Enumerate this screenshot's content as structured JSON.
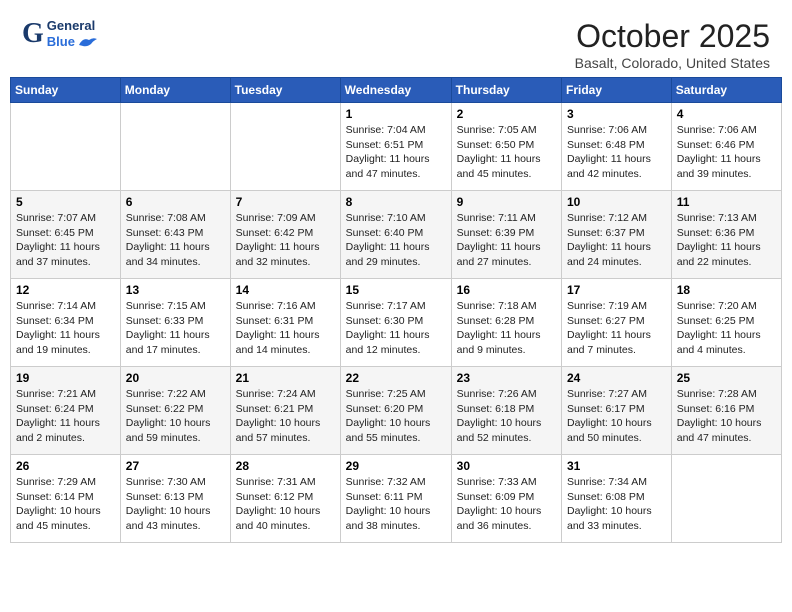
{
  "header": {
    "logo_general": "General",
    "logo_blue": "Blue",
    "month_title": "October 2025",
    "location": "Basalt, Colorado, United States"
  },
  "days_of_week": [
    "Sunday",
    "Monday",
    "Tuesday",
    "Wednesday",
    "Thursday",
    "Friday",
    "Saturday"
  ],
  "weeks": [
    [
      {
        "day": "",
        "info": ""
      },
      {
        "day": "",
        "info": ""
      },
      {
        "day": "",
        "info": ""
      },
      {
        "day": "1",
        "info": "Sunrise: 7:04 AM\nSunset: 6:51 PM\nDaylight: 11 hours\nand 47 minutes."
      },
      {
        "day": "2",
        "info": "Sunrise: 7:05 AM\nSunset: 6:50 PM\nDaylight: 11 hours\nand 45 minutes."
      },
      {
        "day": "3",
        "info": "Sunrise: 7:06 AM\nSunset: 6:48 PM\nDaylight: 11 hours\nand 42 minutes."
      },
      {
        "day": "4",
        "info": "Sunrise: 7:06 AM\nSunset: 6:46 PM\nDaylight: 11 hours\nand 39 minutes."
      }
    ],
    [
      {
        "day": "5",
        "info": "Sunrise: 7:07 AM\nSunset: 6:45 PM\nDaylight: 11 hours\nand 37 minutes."
      },
      {
        "day": "6",
        "info": "Sunrise: 7:08 AM\nSunset: 6:43 PM\nDaylight: 11 hours\nand 34 minutes."
      },
      {
        "day": "7",
        "info": "Sunrise: 7:09 AM\nSunset: 6:42 PM\nDaylight: 11 hours\nand 32 minutes."
      },
      {
        "day": "8",
        "info": "Sunrise: 7:10 AM\nSunset: 6:40 PM\nDaylight: 11 hours\nand 29 minutes."
      },
      {
        "day": "9",
        "info": "Sunrise: 7:11 AM\nSunset: 6:39 PM\nDaylight: 11 hours\nand 27 minutes."
      },
      {
        "day": "10",
        "info": "Sunrise: 7:12 AM\nSunset: 6:37 PM\nDaylight: 11 hours\nand 24 minutes."
      },
      {
        "day": "11",
        "info": "Sunrise: 7:13 AM\nSunset: 6:36 PM\nDaylight: 11 hours\nand 22 minutes."
      }
    ],
    [
      {
        "day": "12",
        "info": "Sunrise: 7:14 AM\nSunset: 6:34 PM\nDaylight: 11 hours\nand 19 minutes."
      },
      {
        "day": "13",
        "info": "Sunrise: 7:15 AM\nSunset: 6:33 PM\nDaylight: 11 hours\nand 17 minutes."
      },
      {
        "day": "14",
        "info": "Sunrise: 7:16 AM\nSunset: 6:31 PM\nDaylight: 11 hours\nand 14 minutes."
      },
      {
        "day": "15",
        "info": "Sunrise: 7:17 AM\nSunset: 6:30 PM\nDaylight: 11 hours\nand 12 minutes."
      },
      {
        "day": "16",
        "info": "Sunrise: 7:18 AM\nSunset: 6:28 PM\nDaylight: 11 hours\nand 9 minutes."
      },
      {
        "day": "17",
        "info": "Sunrise: 7:19 AM\nSunset: 6:27 PM\nDaylight: 11 hours\nand 7 minutes."
      },
      {
        "day": "18",
        "info": "Sunrise: 7:20 AM\nSunset: 6:25 PM\nDaylight: 11 hours\nand 4 minutes."
      }
    ],
    [
      {
        "day": "19",
        "info": "Sunrise: 7:21 AM\nSunset: 6:24 PM\nDaylight: 11 hours\nand 2 minutes."
      },
      {
        "day": "20",
        "info": "Sunrise: 7:22 AM\nSunset: 6:22 PM\nDaylight: 10 hours\nand 59 minutes."
      },
      {
        "day": "21",
        "info": "Sunrise: 7:24 AM\nSunset: 6:21 PM\nDaylight: 10 hours\nand 57 minutes."
      },
      {
        "day": "22",
        "info": "Sunrise: 7:25 AM\nSunset: 6:20 PM\nDaylight: 10 hours\nand 55 minutes."
      },
      {
        "day": "23",
        "info": "Sunrise: 7:26 AM\nSunset: 6:18 PM\nDaylight: 10 hours\nand 52 minutes."
      },
      {
        "day": "24",
        "info": "Sunrise: 7:27 AM\nSunset: 6:17 PM\nDaylight: 10 hours\nand 50 minutes."
      },
      {
        "day": "25",
        "info": "Sunrise: 7:28 AM\nSunset: 6:16 PM\nDaylight: 10 hours\nand 47 minutes."
      }
    ],
    [
      {
        "day": "26",
        "info": "Sunrise: 7:29 AM\nSunset: 6:14 PM\nDaylight: 10 hours\nand 45 minutes."
      },
      {
        "day": "27",
        "info": "Sunrise: 7:30 AM\nSunset: 6:13 PM\nDaylight: 10 hours\nand 43 minutes."
      },
      {
        "day": "28",
        "info": "Sunrise: 7:31 AM\nSunset: 6:12 PM\nDaylight: 10 hours\nand 40 minutes."
      },
      {
        "day": "29",
        "info": "Sunrise: 7:32 AM\nSunset: 6:11 PM\nDaylight: 10 hours\nand 38 minutes."
      },
      {
        "day": "30",
        "info": "Sunrise: 7:33 AM\nSunset: 6:09 PM\nDaylight: 10 hours\nand 36 minutes."
      },
      {
        "day": "31",
        "info": "Sunrise: 7:34 AM\nSunset: 6:08 PM\nDaylight: 10 hours\nand 33 minutes."
      },
      {
        "day": "",
        "info": ""
      }
    ]
  ]
}
